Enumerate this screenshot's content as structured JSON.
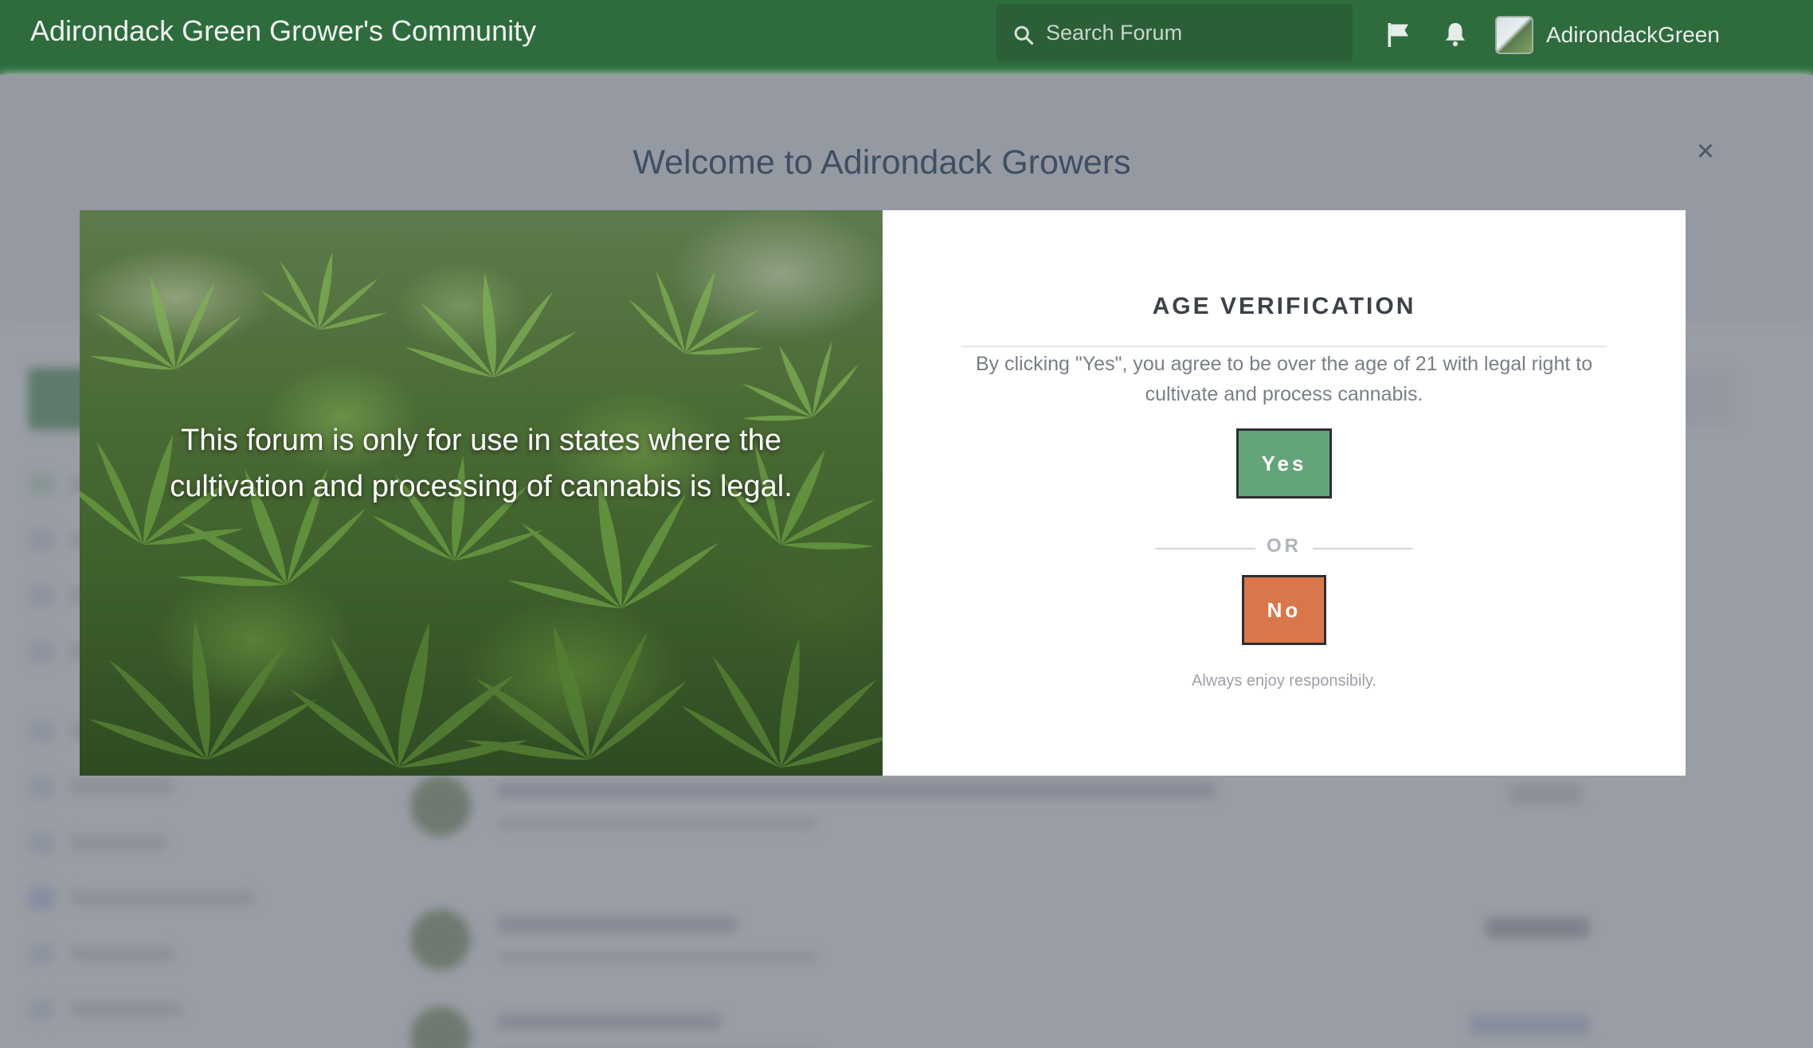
{
  "header": {
    "site_title": "Adirondack Green Grower's Community",
    "search_placeholder": "Search Forum",
    "username": "AdirondackGreen",
    "colors": {
      "header_bg": "#2e6b3d",
      "search_bg": "#2a5f37"
    }
  },
  "modal": {
    "title": "Welcome to Adirondack Growers",
    "close_label": "×",
    "image_caption": "This forum is only for use in states where the cultivation and processing of cannabis is legal.",
    "heading": "AGE VERIFICATION",
    "description": "By clicking \"Yes\", you agree to be over the age of 21 with legal right to cultivate and process cannabis.",
    "yes_label": "Yes",
    "or_label": "OR",
    "no_label": "No",
    "footnote": "Always enjoy responsibily.",
    "colors": {
      "yes": "#64a47a",
      "no": "#d9764a"
    }
  },
  "icons": [
    "search-icon",
    "flag-icon",
    "bell-icon",
    "close-icon",
    "check-icon"
  ]
}
